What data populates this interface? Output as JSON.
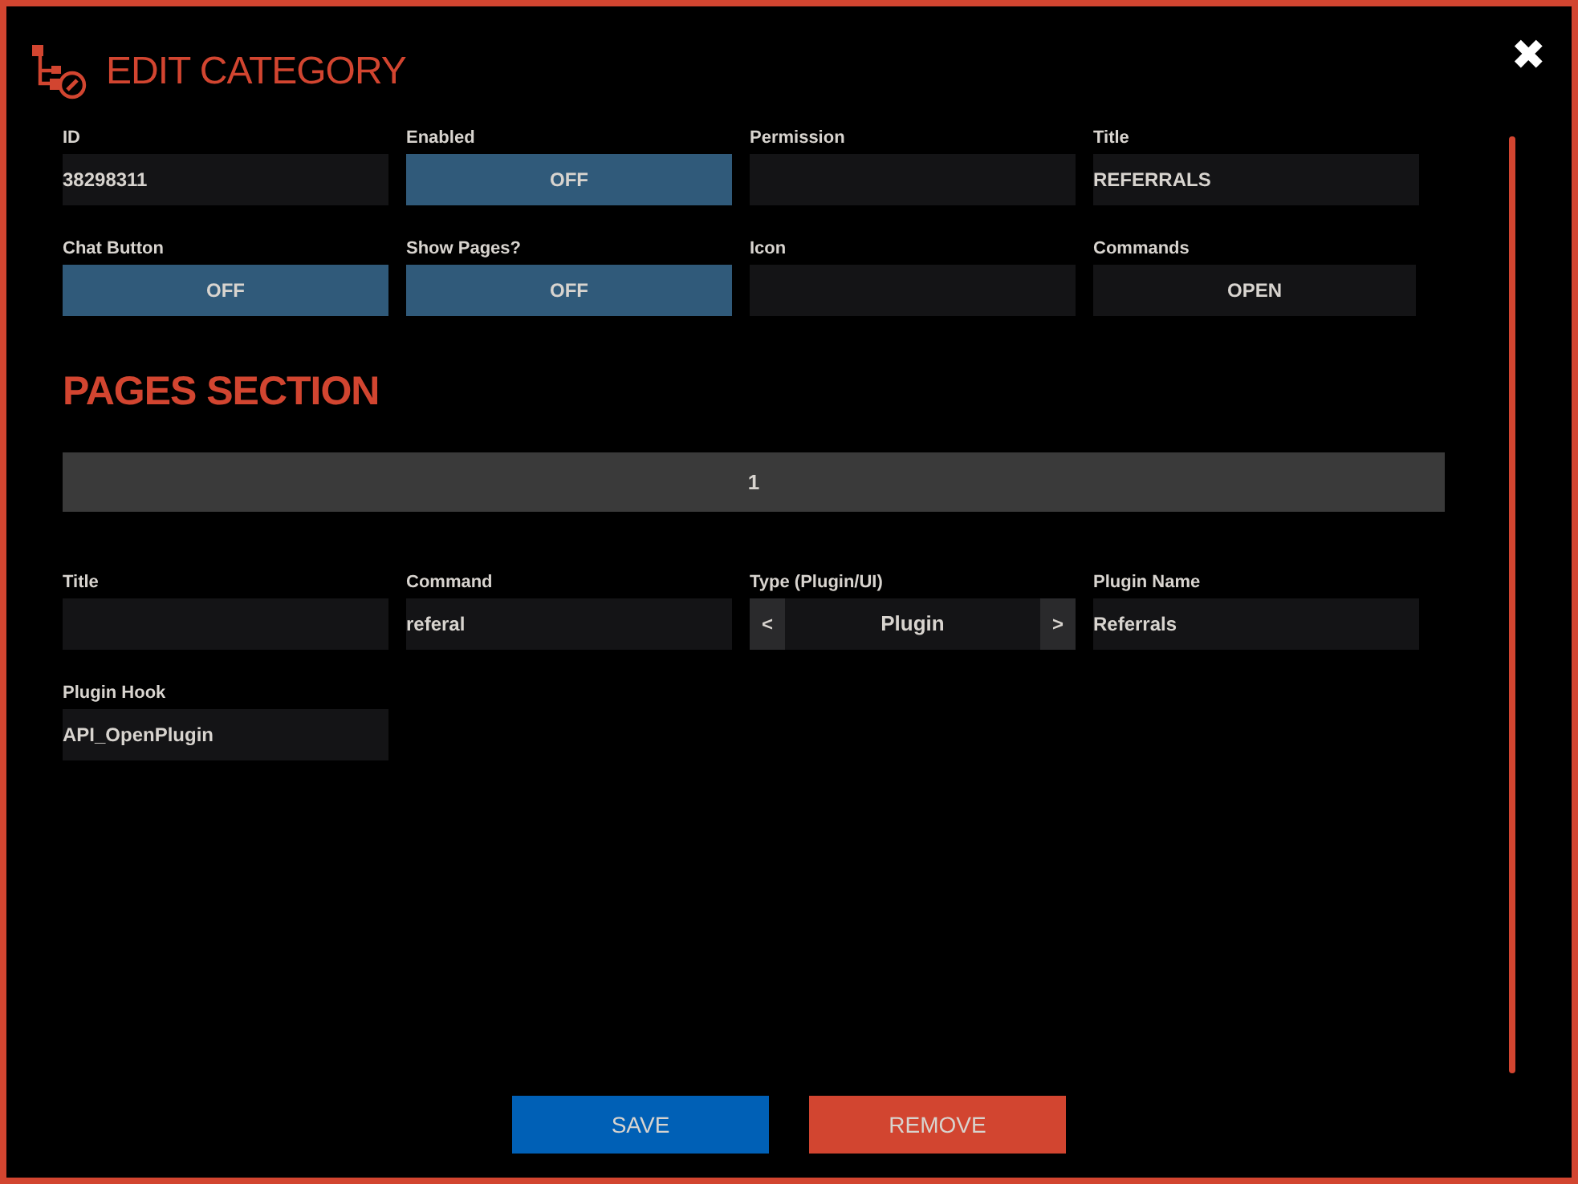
{
  "window": {
    "title": "EDIT CATEGORY",
    "close": "✖"
  },
  "category_fields": [
    {
      "label": "ID",
      "kind": "text",
      "value": "38298311"
    },
    {
      "label": "Enabled",
      "kind": "toggle",
      "value": "OFF"
    },
    {
      "label": "Permission",
      "kind": "text"
    },
    {
      "label": "Title",
      "kind": "text",
      "value": "REFERRALS"
    },
    {
      "label": "Chat Button",
      "kind": "toggle",
      "value": "OFF"
    },
    {
      "label": "Show Pages?",
      "kind": "toggle",
      "value": "OFF"
    },
    {
      "label": "Icon",
      "kind": "text"
    },
    {
      "label": "Commands",
      "kind": "button",
      "value": "OPEN"
    }
  ],
  "pages_section": {
    "heading": "PAGES SECTION",
    "page_tab": "1",
    "fields": [
      {
        "label": "Title",
        "kind": "text"
      },
      {
        "label": "Command",
        "kind": "text",
        "value": "referal"
      },
      {
        "label": "Type (Plugin/UI)",
        "kind": "selector",
        "value": "Plugin",
        "prev": "<",
        "next": ">"
      },
      {
        "label": "Plugin Name",
        "kind": "text",
        "value": "Referrals"
      },
      {
        "label": "Plugin Hook",
        "kind": "text",
        "value": "API_OpenPlugin"
      }
    ]
  },
  "buttons": [
    {
      "label": "SAVE",
      "kind": "save"
    },
    {
      "label": "REMOVE",
      "kind": "remove"
    }
  ]
}
